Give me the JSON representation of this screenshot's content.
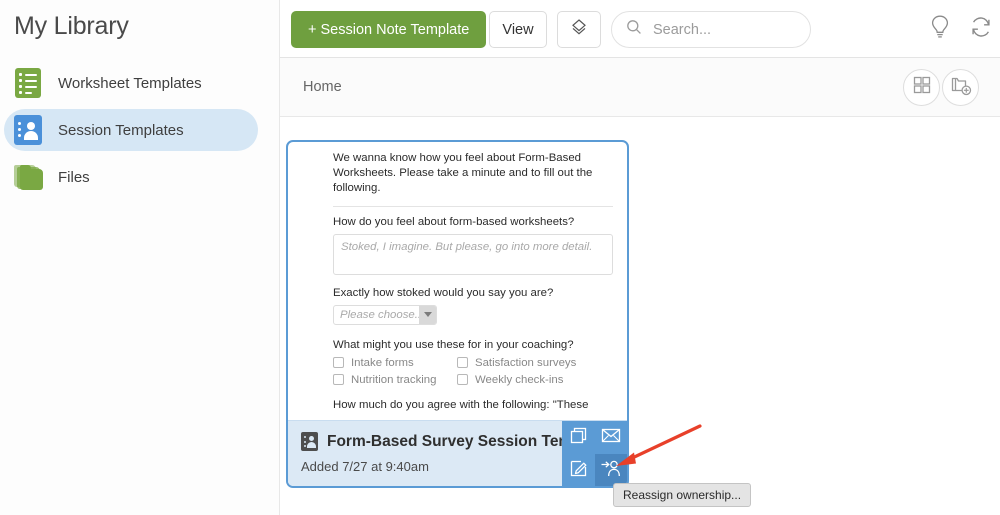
{
  "sidebar": {
    "title": "My Library",
    "items": [
      {
        "label": "Worksheet Templates",
        "icon": "list-icon",
        "active": false
      },
      {
        "label": "Session Templates",
        "icon": "person-card-icon",
        "active": true
      },
      {
        "label": "Files",
        "icon": "folder-icon",
        "active": false
      }
    ]
  },
  "toolbar": {
    "new_template_label": "+ Session Note Template",
    "view_label": "View",
    "sort_icon": "sort-diamond-icon",
    "search_placeholder": "Search...",
    "search_value": "",
    "search_icon": "search-icon",
    "bulb_icon": "lightbulb-icon",
    "sync_icon": "sync-icon"
  },
  "crumbbar": {
    "breadcrumb": "Home",
    "grid_view_icon": "grid-view-icon",
    "new_folder_icon": "new-folder-icon"
  },
  "card": {
    "preview": {
      "intro": "We wanna know how you feel about Form-Based Worksheets. Please take a minute and to fill out the following.",
      "q1_label": "How do you feel about form-based worksheets?",
      "q1_placeholder": "Stoked, I imagine. But please, go into more detail.",
      "q2_label": "Exactly how stoked would you say you are?",
      "q2_value": "Please choose...",
      "q3_label": "What might you use these for in your coaching?",
      "q3_options": [
        "Intake forms",
        "Satisfaction surveys",
        "Nutrition tracking",
        "Weekly check-ins"
      ],
      "q4_label": "How much do you agree with the following: \"These"
    },
    "title": "Form-Based Survey Session Temp",
    "subtitle": "Added 7/27 at 9:40am",
    "title_icon": "person-card-icon",
    "actions": [
      {
        "name": "duplicate",
        "icon": "copy-icon",
        "active": false
      },
      {
        "name": "email",
        "icon": "envelope-icon",
        "active": false
      },
      {
        "name": "edit",
        "icon": "pencil-square-icon",
        "active": false
      },
      {
        "name": "reassign",
        "icon": "reassign-person-icon",
        "active": true
      }
    ]
  },
  "tooltip": {
    "text": "Reassign ownership..."
  },
  "annotation": {
    "arrow_color": "#e8402a"
  },
  "colors": {
    "brand_green": "#6f9f3f",
    "accent_blue": "#5b9bd5",
    "selected_blue": "#d6e7f5",
    "card_footer_blue": "#dce9f5",
    "icon_green": "#7aa843",
    "icon_blue": "#4a90d9"
  }
}
